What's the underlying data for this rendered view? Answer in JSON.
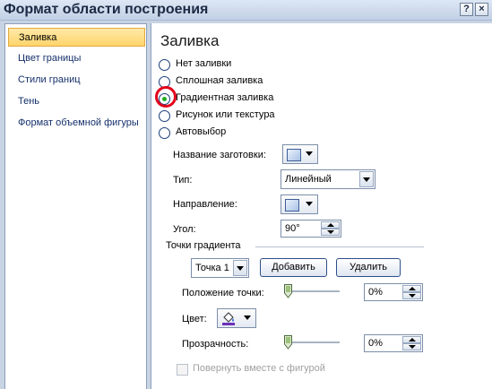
{
  "window": {
    "title": "Формат области построения",
    "help_label": "?",
    "close_label": "×"
  },
  "sidebar": {
    "items": [
      {
        "label": "Заливка"
      },
      {
        "label": "Цвет границы"
      },
      {
        "label": "Стили границ"
      },
      {
        "label": "Тень"
      },
      {
        "label": "Формат объемной фигуры"
      }
    ],
    "selected": "Заливка"
  },
  "panel": {
    "heading": "Заливка",
    "fill_options": [
      {
        "label": "Нет заливки",
        "checked": false
      },
      {
        "label": "Сплошная заливка",
        "checked": false
      },
      {
        "label": "Градиентная заливка",
        "checked": true
      },
      {
        "label": "Рисунок или текстура",
        "checked": false
      },
      {
        "label": "Автовыбор",
        "checked": false
      }
    ],
    "preset_label": "Название заготовки:",
    "type_label": "Тип:",
    "type_value": "Линейный",
    "direction_label": "Направление:",
    "angle_label": "Угол:",
    "angle_value": "90°",
    "stops_label": "Точки градиента",
    "stop_value": "Точка 1",
    "add_button": "Добавить",
    "remove_button": "Удалить",
    "position_label": "Положение точки:",
    "position_value": "0%",
    "color_label": "Цвет:",
    "transparency_label": "Прозрачность:",
    "transparency_value": "0%",
    "rotate_label": "Повернуть вместе с фигурой"
  },
  "colors": {
    "highlight_ring": "#e3001b",
    "selected_item": "#ffd46b",
    "radio_dot": "#1fae1f"
  }
}
